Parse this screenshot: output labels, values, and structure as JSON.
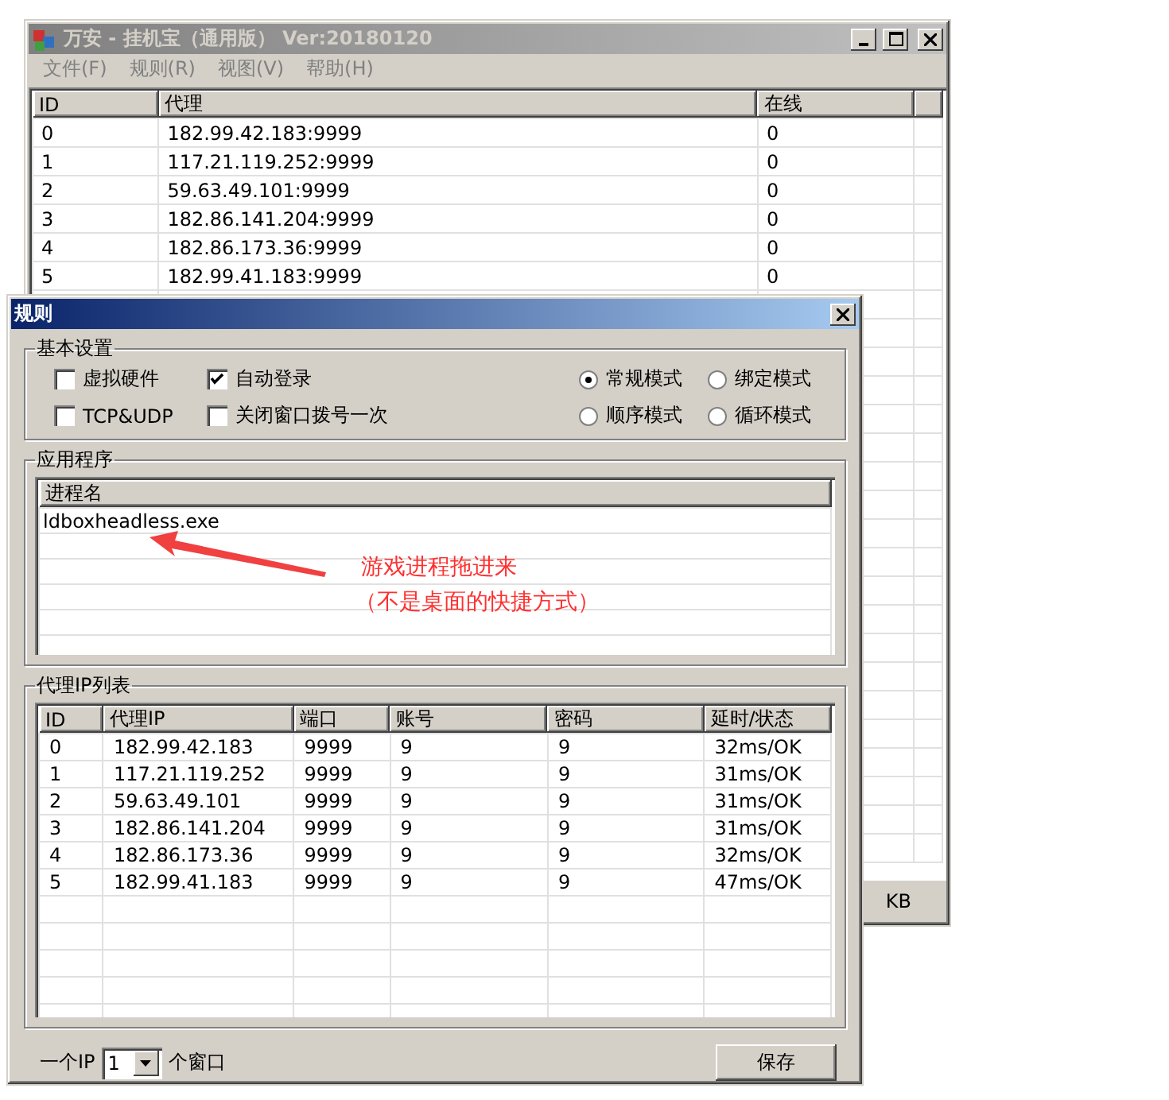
{
  "main_window": {
    "title": "万安 - 挂机宝（通用版） Ver:20180120",
    "menu": [
      "文件(F)",
      "规则(R)",
      "视图(V)",
      "帮助(H)"
    ],
    "table": {
      "columns": [
        "ID",
        "代理",
        "在线"
      ],
      "rows": [
        [
          "0",
          "182.99.42.183:9999",
          "0"
        ],
        [
          "1",
          "117.21.119.252:9999",
          "0"
        ],
        [
          "2",
          "59.63.49.101:9999",
          "0"
        ],
        [
          "3",
          "182.86.141.204:9999",
          "0"
        ],
        [
          "4",
          "182.86.173.36:9999",
          "0"
        ],
        [
          "5",
          "182.99.41.183:9999",
          "0"
        ]
      ]
    },
    "status_bar": "KB"
  },
  "dialog": {
    "title": "规则",
    "basic_settings": {
      "label": "基本设置",
      "checkboxes": [
        {
          "label": "虚拟硬件",
          "checked": false
        },
        {
          "label": "自动登录",
          "checked": true
        },
        {
          "label": "TCP&UDP",
          "checked": false
        },
        {
          "label": "关闭窗口拨号一次",
          "checked": false
        }
      ],
      "radios": [
        {
          "label": "常规模式",
          "selected": true
        },
        {
          "label": "绑定模式",
          "selected": false
        },
        {
          "label": "顺序模式",
          "selected": false
        },
        {
          "label": "循环模式",
          "selected": false
        }
      ]
    },
    "applications": {
      "label": "应用程序",
      "column": "进程名",
      "rows": [
        "ldboxheadless.exe"
      ]
    },
    "annotation": {
      "lines": [
        "游戏进程拖进来",
        "（不是桌面的快捷方式）"
      ]
    },
    "proxy_list": {
      "label": "代理IP列表",
      "columns": [
        "ID",
        "代理IP",
        "端口",
        "账号",
        "密码",
        "延时/状态"
      ],
      "rows": [
        [
          "0",
          "182.99.42.183",
          "9999",
          "9",
          "9",
          "32ms/OK"
        ],
        [
          "1",
          "117.21.119.252",
          "9999",
          "9",
          "9",
          "31ms/OK"
        ],
        [
          "2",
          "59.63.49.101",
          "9999",
          "9",
          "9",
          "31ms/OK"
        ],
        [
          "3",
          "182.86.141.204",
          "9999",
          "9",
          "9",
          "31ms/OK"
        ],
        [
          "4",
          "182.86.173.36",
          "9999",
          "9",
          "9",
          "32ms/OK"
        ],
        [
          "5",
          "182.99.41.183",
          "9999",
          "9",
          "9",
          "47ms/OK"
        ]
      ]
    },
    "per_ip": {
      "before": "一个IP",
      "value": "1",
      "after": "个窗口"
    },
    "save_button": "保存"
  }
}
